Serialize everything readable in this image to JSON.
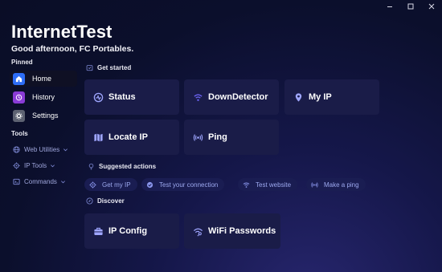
{
  "app": {
    "title": "InternetTest",
    "greeting": "Good afternoon, FC Portables."
  },
  "window_controls": {
    "minimize": "minimize-icon",
    "maximize": "maximize-icon",
    "close": "close-icon"
  },
  "sidebar": {
    "pinned_label": "Pinned",
    "pinned": [
      {
        "label": "Home",
        "icon": "home-icon",
        "color": "#2d6df6",
        "active": true
      },
      {
        "label": "History",
        "icon": "history-icon",
        "color": "#8a3bd6",
        "active": false
      },
      {
        "label": "Settings",
        "icon": "gear-icon",
        "color": "#5d6272",
        "active": false
      }
    ],
    "tools_label": "Tools",
    "tools": [
      {
        "label": "Web Utilities",
        "icon": "globe-icon"
      },
      {
        "label": "IP Tools",
        "icon": "location-icon"
      },
      {
        "label": "Commands",
        "icon": "command-icon"
      }
    ]
  },
  "main": {
    "get_started": {
      "heading": "Get started",
      "cards": [
        {
          "label": "Status",
          "icon": "status-icon"
        },
        {
          "label": "DownDetector",
          "icon": "wifi-icon"
        },
        {
          "label": "My IP",
          "icon": "location-pin-icon"
        },
        {
          "label": "Locate IP",
          "icon": "map-icon"
        },
        {
          "label": "Ping",
          "icon": "ping-icon"
        }
      ]
    },
    "suggested": {
      "heading": "Suggested actions",
      "actions": [
        {
          "label": "Get my IP",
          "icon": "location-icon"
        },
        {
          "label": "Test your connection",
          "icon": "check-circle-icon"
        },
        {
          "label": "Test website",
          "icon": "wifi-icon"
        },
        {
          "label": "Make a ping",
          "icon": "ping-icon"
        }
      ]
    },
    "discover": {
      "heading": "Discover",
      "cards": [
        {
          "label": "IP Config",
          "icon": "toolbox-icon"
        },
        {
          "label": "WiFi Passwords",
          "icon": "wifi-key-icon"
        }
      ]
    }
  },
  "colors": {
    "accent": "#5b74ff",
    "card_bg": "#1a1c48",
    "chip_text": "#9ca8ee",
    "background": "#0b0f2c"
  }
}
